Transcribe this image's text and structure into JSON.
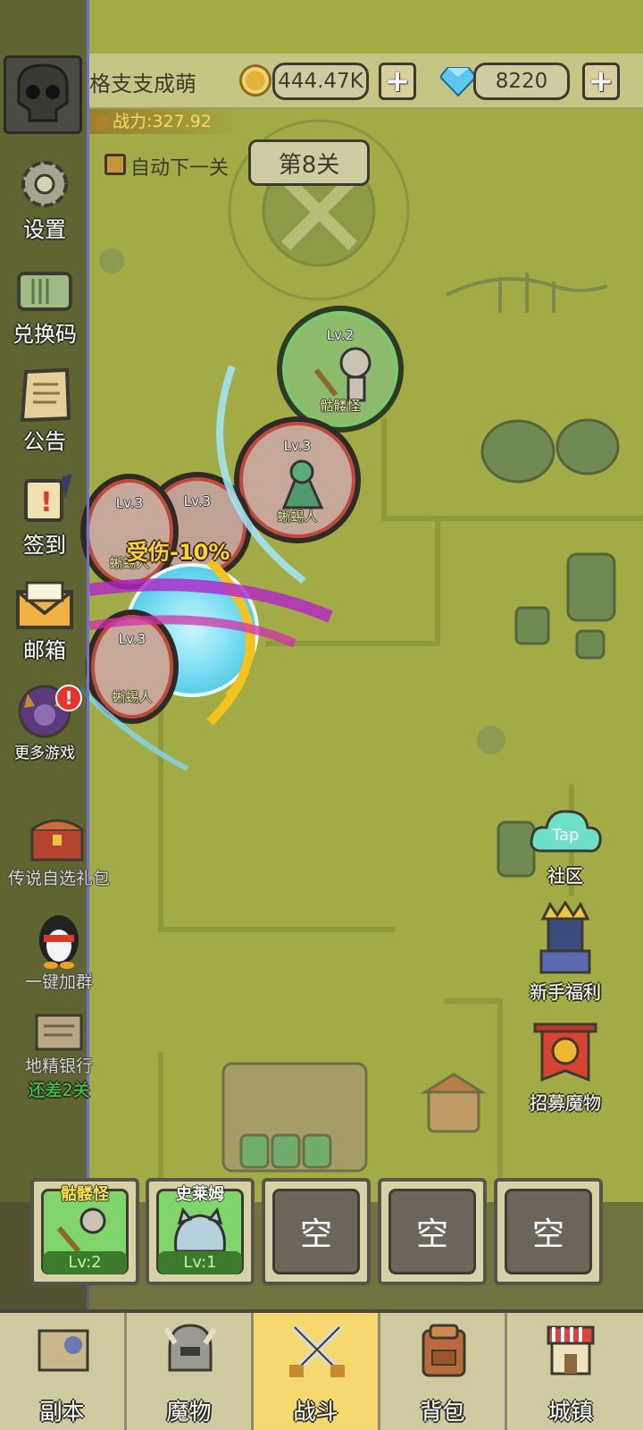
{
  "player": {
    "name": "格支支成萌",
    "power": "战力:327.92"
  },
  "currency": {
    "gold": "444.47K",
    "gems": "8220",
    "plus": "+"
  },
  "stage": {
    "auto_next_label": "自动下一关",
    "current": "第8关"
  },
  "left_menu": [
    {
      "id": "settings",
      "label": "设置",
      "icon": "gear-icon"
    },
    {
      "id": "redeem",
      "label": "兑换码",
      "icon": "ticket-icon"
    },
    {
      "id": "notice",
      "label": "公告",
      "icon": "scroll-icon"
    },
    {
      "id": "checkin",
      "label": "签到",
      "icon": "quill-scroll-icon"
    },
    {
      "id": "mail",
      "label": "邮箱",
      "icon": "envelope-icon"
    },
    {
      "id": "more_games",
      "label": "更多游戏",
      "icon": "demon-avatar-icon",
      "alert": "!"
    },
    {
      "id": "legend_pack",
      "label": "传说自选礼包",
      "icon": "treasure-chest-icon"
    },
    {
      "id": "join_group",
      "label": "一键加群",
      "icon": "penguin-icon"
    },
    {
      "id": "goblin_bank",
      "label": "地精银行",
      "sublabel": "还差2关",
      "icon": "bank-scroll-icon"
    }
  ],
  "right_menu": [
    {
      "id": "community",
      "label": "社区",
      "icon": "tap-cloud-icon",
      "badge": "Tap"
    },
    {
      "id": "newbie",
      "label": "新手福利",
      "icon": "knight-icon"
    },
    {
      "id": "recruit",
      "label": "招募魔物",
      "icon": "banner-helmet-icon"
    }
  ],
  "battle": {
    "enemy_units": [
      {
        "level": "Lv.2",
        "name": "骷髅怪"
      },
      {
        "level": "Lv.3",
        "name": "蜥蜴人"
      },
      {
        "level": "Lv.3",
        "name": ""
      },
      {
        "level": "Lv.3",
        "name": "蜥蜴人"
      },
      {
        "level": "Lv.3",
        "name": "蜥蜴人"
      }
    ],
    "status_text": "受伤",
    "damage_text": "-10%"
  },
  "squad": [
    {
      "name": "骷髅怪",
      "level": "Lv:2",
      "filled": true
    },
    {
      "name": "史莱姆",
      "level": "Lv:1",
      "filled": true
    },
    {
      "name": "空",
      "filled": false
    },
    {
      "name": "空",
      "filled": false
    },
    {
      "name": "空",
      "filled": false
    }
  ],
  "bottom_nav": [
    {
      "id": "dungeon",
      "label": "副本",
      "icon": "map-icon"
    },
    {
      "id": "monsters",
      "label": "魔物",
      "icon": "helmet-icon"
    },
    {
      "id": "battle",
      "label": "战斗",
      "icon": "crossed-swords-icon",
      "active": true
    },
    {
      "id": "bag",
      "label": "背包",
      "icon": "backpack-icon"
    },
    {
      "id": "town",
      "label": "城镇",
      "icon": "shop-icon"
    }
  ],
  "colors": {
    "accent": "#f6d96e",
    "map_bg": "#a3ab47",
    "divider": "#6d74d6"
  }
}
